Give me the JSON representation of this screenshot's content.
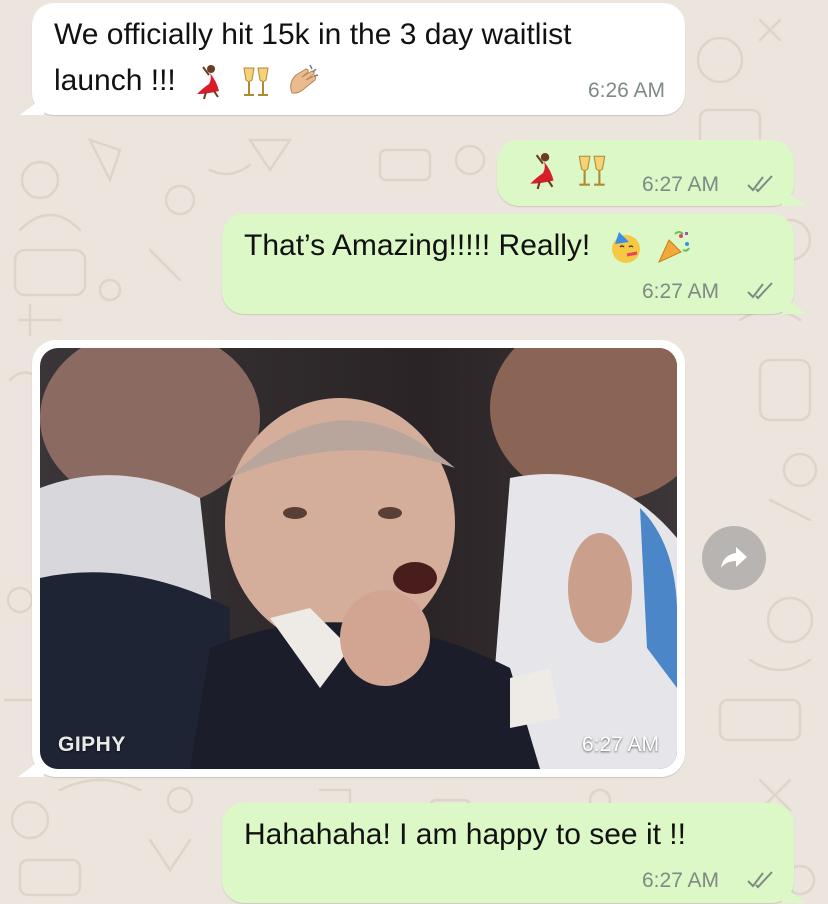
{
  "colors": {
    "chat_background": "#ece5dd",
    "incoming_bubble": "#ffffff",
    "outgoing_bubble": "#dcf8c6",
    "timestamp": "#7e8a84",
    "read_ticks": "#7e8a84"
  },
  "messages": [
    {
      "direction": "incoming",
      "line1": "We officially hit 15k in the 3 day waitlist",
      "line2": "launch !!!",
      "emoji": [
        "dancer-emoji",
        "champagne-glasses-emoji",
        "clapping-hands-emoji"
      ],
      "time": "6:26 AM"
    },
    {
      "direction": "outgoing",
      "emoji": [
        "dancer-emoji",
        "champagne-glasses-emoji"
      ],
      "time": "6:27 AM",
      "status": "read"
    },
    {
      "direction": "outgoing",
      "text": "That’s Amazing!!!!! Really!",
      "emoji": [
        "partying-face-emoji",
        "party-popper-emoji"
      ],
      "time": "6:27 AM",
      "status": "read"
    },
    {
      "direction": "incoming",
      "type": "gif",
      "gif_label": "GIPHY",
      "time": "6:27 AM",
      "action_icon": "forward-icon"
    },
    {
      "direction": "outgoing",
      "text": "Hahahaha! I am happy to see it !!",
      "time": "6:27 AM",
      "status": "read"
    }
  ]
}
